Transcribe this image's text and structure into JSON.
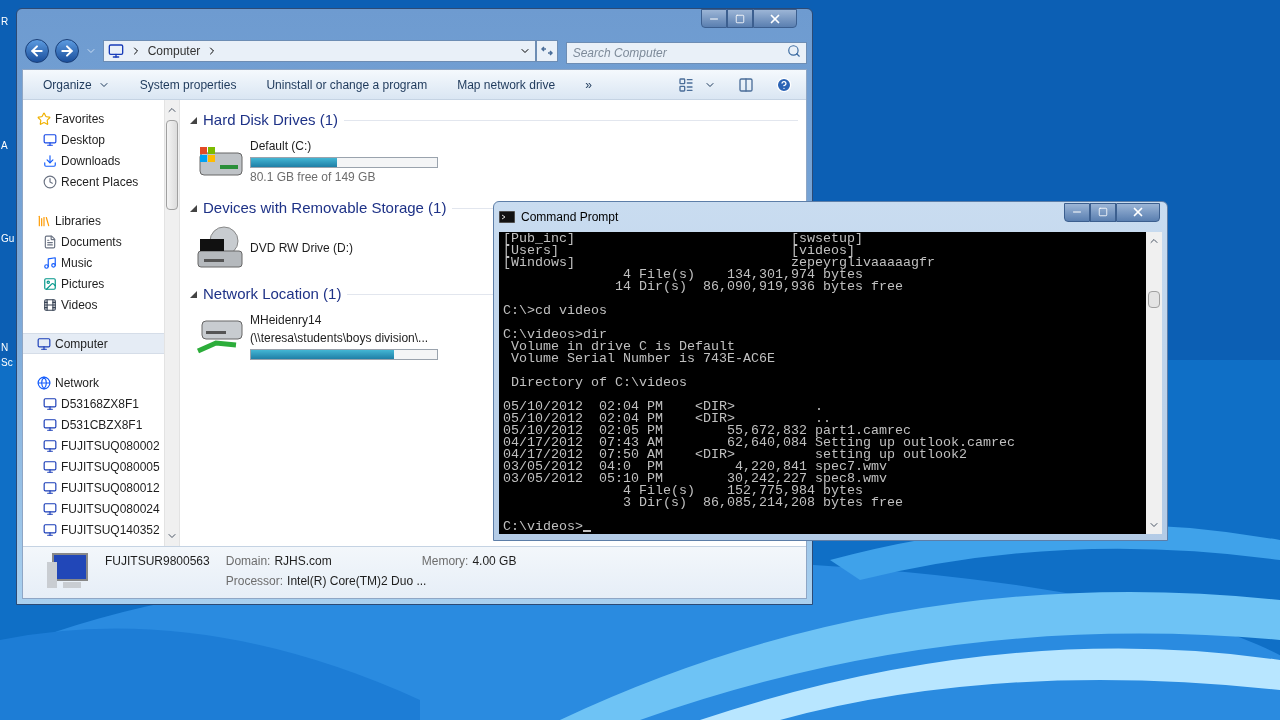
{
  "desktop": {
    "labels": [
      {
        "text": "R"
      },
      {
        "text": "A"
      },
      {
        "text": "Gu"
      },
      {
        "text": "N"
      },
      {
        "text": "Sc"
      }
    ]
  },
  "explorer": {
    "breadcrumb": [
      "Computer"
    ],
    "search": {
      "placeholder": "Search Computer"
    },
    "toolbar": [
      {
        "label": "Organize",
        "kind": "menu"
      },
      {
        "label": "System properties",
        "kind": "plain"
      },
      {
        "label": "Uninstall or change a program",
        "kind": "plain"
      },
      {
        "label": "Map network drive",
        "kind": "plain"
      },
      {
        "label": "»",
        "kind": "plain"
      }
    ],
    "nav": [
      {
        "label": "Favorites",
        "kind": "star",
        "selected": false,
        "children": [
          {
            "label": "Desktop",
            "kind": "desktop",
            "selected": false
          },
          {
            "label": "Downloads",
            "kind": "downloads",
            "selected": false
          },
          {
            "label": "Recent Places",
            "kind": "recent",
            "selected": false
          }
        ]
      },
      {
        "label": "Libraries",
        "kind": "libraries",
        "selected": false,
        "children": [
          {
            "label": "Documents",
            "kind": "documents",
            "selected": false
          },
          {
            "label": "Music",
            "kind": "music",
            "selected": false
          },
          {
            "label": "Pictures",
            "kind": "pictures",
            "selected": false
          },
          {
            "label": "Videos",
            "kind": "videos",
            "selected": false
          }
        ]
      },
      {
        "label": "Computer",
        "kind": "computer",
        "selected": true
      },
      {
        "label": "Network",
        "kind": "network",
        "selected": false,
        "children": [
          {
            "label": "D53168ZX8F1",
            "kind": "computer",
            "selected": false
          },
          {
            "label": "D531CBZX8F1",
            "kind": "computer",
            "selected": false
          },
          {
            "label": "FUJITSUQ080002",
            "kind": "computer",
            "selected": false
          },
          {
            "label": "FUJITSUQ080005",
            "kind": "computer",
            "selected": false
          },
          {
            "label": "FUJITSUQ080012",
            "kind": "computer",
            "selected": false
          },
          {
            "label": "FUJITSUQ080024",
            "kind": "computer",
            "selected": false
          },
          {
            "label": "FUJITSUQ140352",
            "kind": "computer",
            "selected": false
          }
        ]
      }
    ],
    "groups": [
      {
        "title": "Hard Disk Drives (1)",
        "items": [
          {
            "kind": "disk",
            "name": "Default (C:)",
            "level": 0.46,
            "info": "80.1 GB free of 149 GB"
          }
        ]
      },
      {
        "title": "Devices with Removable Storage (1)",
        "items": [
          {
            "kind": "dvd",
            "name": "DVD RW Drive (D:)"
          }
        ]
      },
      {
        "title": "Network Location (1)",
        "items": [
          {
            "kind": "network",
            "name": "MHeidenry14",
            "path": "(\\\\teresa\\students\\boys division\\...",
            "level": 0.77
          }
        ]
      }
    ],
    "details": {
      "name": "FUJITSUR9800563",
      "fields": [
        {
          "label": "Domain:",
          "value": "RJHS.com"
        },
        {
          "label": "Memory:",
          "value": "4.00 GB"
        },
        {
          "label": "Processor:",
          "value": "Intel(R) Core(TM)2 Duo ..."
        }
      ]
    }
  },
  "cmd": {
    "title": "Command Prompt",
    "blocks": [
      [
        "[Pub_inc]                           [swsetup]",
        "[Users]                             [videos]",
        "[Windows]                           zepeyrglivaaaaagfr",
        "               4 File(s)    134,301,974 bytes",
        "              14 Dir(s)  86,090,919,936 bytes free"
      ],
      [
        "C:\\>cd videos"
      ],
      [
        "C:\\videos>dir",
        " Volume in drive C is Default",
        " Volume Serial Number is 743E-AC6E"
      ],
      [
        " Directory of C:\\videos"
      ],
      [
        "05/10/2012  02:04 PM    <DIR>          .",
        "05/10/2012  02:04 PM    <DIR>          ..",
        "05/10/2012  02:05 PM        55,672,832 part1.camrec",
        "04/17/2012  07:43 AM        62,640,084 Setting up outlook.camrec",
        "04/17/2012  07:50 AM    <DIR>          setting up outlook2",
        "03/05/2012  04:0  PM         4,220,841 spec7.wmv",
        "03/05/2012  05:10 PM        30,242,227 spec8.wmv",
        "               4 File(s)    152,775,984 bytes",
        "               3 Dir(s)  86,085,214,208 bytes free"
      ],
      [
        "C:\\videos>"
      ]
    ]
  }
}
